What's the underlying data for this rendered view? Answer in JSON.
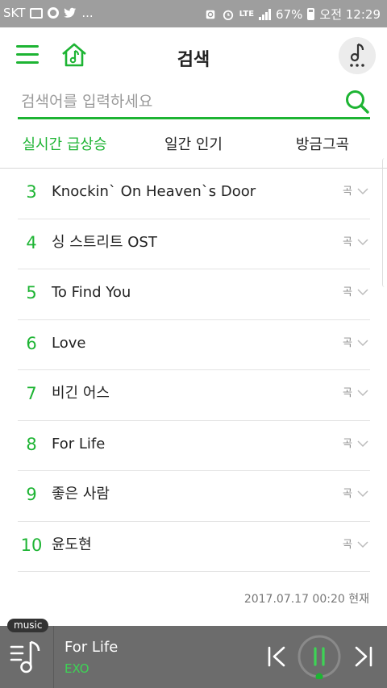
{
  "status_bar": {
    "carrier": "SKT",
    "more": "...",
    "network": "LTE",
    "battery": "67%",
    "time": "오전 12:29"
  },
  "header": {
    "title": "검색",
    "menu_icon": "hamburger-menu-icon",
    "home_icon": "music-home-icon",
    "note_icon": "music-note-icon"
  },
  "search": {
    "placeholder": "검색어를 입력하세요",
    "value": ""
  },
  "tabs": [
    {
      "label": "실시간 급상승",
      "active": true
    },
    {
      "label": "일간 인기",
      "active": false
    },
    {
      "label": "방금그곡",
      "active": false
    }
  ],
  "chart": [
    {
      "rank": "3",
      "title": "Knockin` On Heaven`s Door",
      "type": "곡"
    },
    {
      "rank": "4",
      "title": "싱 스트리트 OST",
      "type": "곡"
    },
    {
      "rank": "5",
      "title": "To Find You",
      "type": "곡"
    },
    {
      "rank": "6",
      "title": "Love",
      "type": "곡"
    },
    {
      "rank": "7",
      "title": "비긴 어스",
      "type": "곡"
    },
    {
      "rank": "8",
      "title": "For Life",
      "type": "곡"
    },
    {
      "rank": "9",
      "title": "좋은 사람",
      "type": "곡"
    },
    {
      "rank": "10",
      "title": "윤도현",
      "type": "곡"
    }
  ],
  "timestamp": "2017.07.17 00:20 현재",
  "player": {
    "badge": "music",
    "track_title": "For Life",
    "artist": "EXO",
    "progress": 0.02
  },
  "colors": {
    "accent": "#1db433",
    "player_bg": "#6c6c6c",
    "status_bg": "#9e9e9e"
  }
}
